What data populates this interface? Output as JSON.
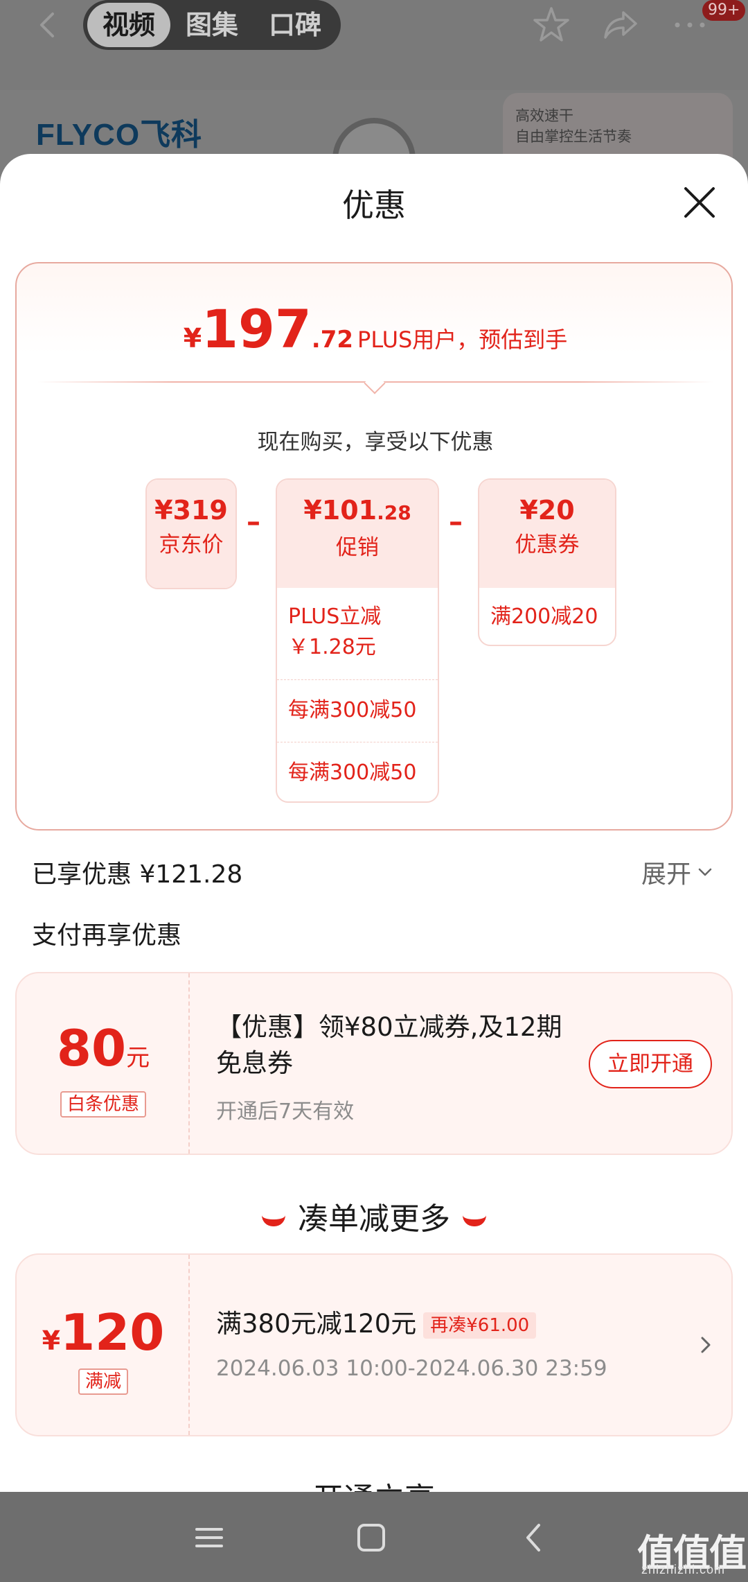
{
  "background": {
    "tabs": [
      "视频",
      "图集",
      "口碑"
    ],
    "active_tab": "视频",
    "badge": "99+",
    "brand_logo": "FLYCO飞科",
    "card_lines": [
      "高效速干",
      "自由掌控生活节奏"
    ]
  },
  "sheet": {
    "title": "优惠"
  },
  "estimate": {
    "currency": "¥",
    "integer": "197",
    "decimal": ".72",
    "label": "PLUS用户，预估到手"
  },
  "breakdown": {
    "note": "现在购买，享受以下优惠",
    "list_price": {
      "amount": "¥319",
      "label": "京东价"
    },
    "promotion": {
      "amount_int": "¥101",
      "amount_dec": ".28",
      "label": "促销",
      "items": [
        "PLUS立减\n￥1.28元",
        "每满300减50",
        "每满300减50"
      ]
    },
    "coupon": {
      "amount": "¥20",
      "label": "优惠券",
      "items": [
        "满200减20"
      ]
    },
    "minus": "–"
  },
  "enjoyed": {
    "text": "已享优惠 ¥121.28",
    "expand_label": "展开"
  },
  "pay_section": {
    "title": "支付再享优惠",
    "card": {
      "amount": "80",
      "unit": "元",
      "tag": "白条优惠",
      "title": "【优惠】领¥80立减券,及12期免息券",
      "subtitle": "开通后7天有效",
      "button": "立即开通"
    }
  },
  "more_section": {
    "title": "凑单减更多",
    "card": {
      "yen": "¥",
      "amount": "120",
      "tag": "满减",
      "title": "满380元减120元",
      "fill_tag": "再凑¥61.00",
      "period": "2024.06.03 10:00-2024.06.30 23:59"
    }
  },
  "peek_section": {
    "title": "开通立享"
  },
  "watermark": {
    "main": "值值值",
    "sub": "zhizhizhi.com"
  },
  "colors": {
    "accent": "#e2231a",
    "card_border": "#e7a99f",
    "coupon_bg": "#fff4f2"
  }
}
